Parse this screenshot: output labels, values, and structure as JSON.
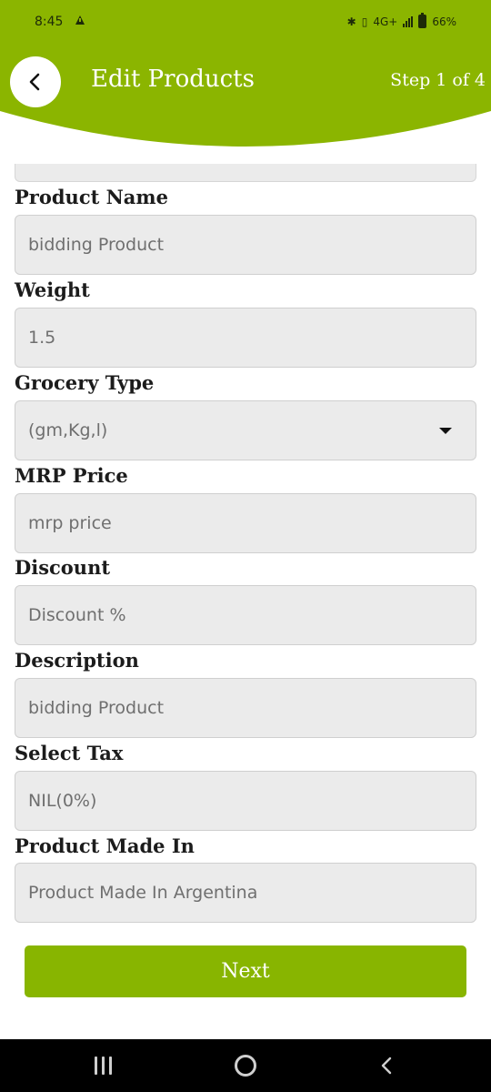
{
  "status_bar": {
    "time": "8:45",
    "network": "4G+",
    "battery": "66%"
  },
  "header": {
    "title": "Edit Products",
    "step": "Step 1 of 4",
    "accent_color": "#8bb500"
  },
  "form": {
    "fields": [
      {
        "label": "Product Name",
        "value": "bidding Product"
      },
      {
        "label": "Weight",
        "value": "1.5"
      },
      {
        "label": "Grocery Type",
        "value": "(gm,Kg,l)"
      },
      {
        "label": "MRP Price",
        "value": "mrp price"
      },
      {
        "label": "Discount",
        "value": "Discount %"
      },
      {
        "label": "Description",
        "value": "bidding Product"
      },
      {
        "label": "Select Tax",
        "value": "NIL(0%)"
      },
      {
        "label": "Product Made In",
        "value": "Product Made In Argentina"
      }
    ],
    "next_label": "Next"
  },
  "icons": {
    "back": "chevron-left-icon",
    "dropdown": "caret-down-icon",
    "nav_recent": "recent-apps-icon",
    "nav_home": "home-circle-icon",
    "nav_back": "back-chevron-icon"
  }
}
